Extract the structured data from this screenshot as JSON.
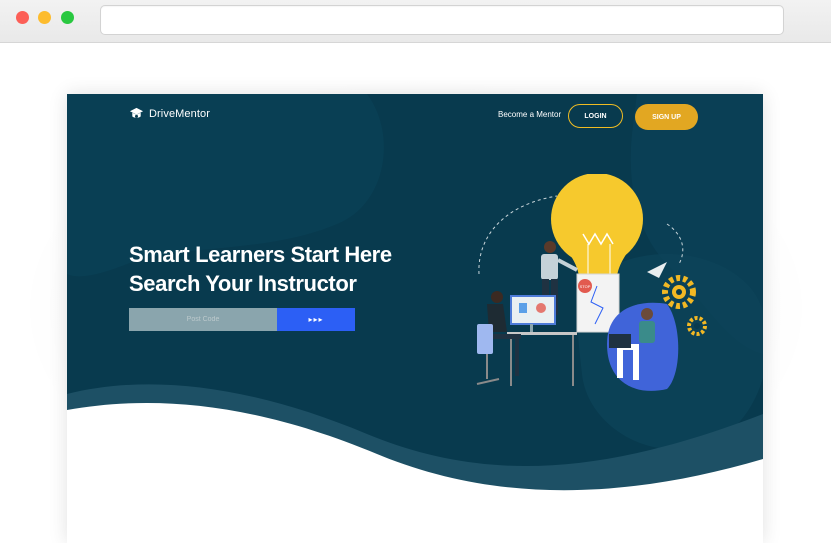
{
  "browser": {
    "controls": [
      "close",
      "minimize",
      "maximize"
    ],
    "address_value": ""
  },
  "header": {
    "brand": "DriveMentor",
    "brand_icon": "mortarboard-icon",
    "nav_link": "Become a Mentor",
    "login_label": "LOGIN",
    "signup_label": "SIGN UP"
  },
  "hero": {
    "title_line1": "Smart Learners Start Here",
    "title_line2": "Search Your Instructor",
    "search_placeholder": "Post Code",
    "search_button_label": "▸▸▸"
  },
  "illustration": {
    "stop_sign_text": "STOP"
  },
  "colors": {
    "background": "#083a4e",
    "accent_yellow": "#e2a722",
    "search_button": "#2c5ff5",
    "input_fill": "#8aa5ad"
  }
}
